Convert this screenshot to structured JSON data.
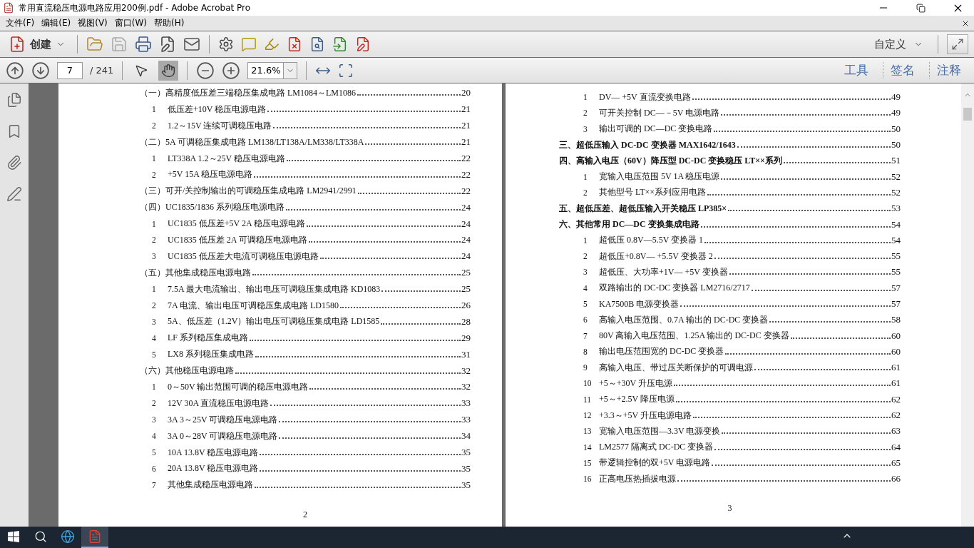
{
  "window": {
    "title": "常用直流稳压电源电路应用200例.pdf - Adobe Acrobat Pro"
  },
  "menu": [
    "文件(F)",
    "编辑(E)",
    "视图(V)",
    "窗口(W)",
    "帮助(H)"
  ],
  "toolbar": {
    "create": "创建",
    "customize": "自定义"
  },
  "navigation": {
    "page": "7",
    "page_count": "/ 241",
    "zoom": "21.6%",
    "tools": [
      {
        "kind": "select",
        "selected": false
      },
      {
        "kind": "hand",
        "selected": true
      }
    ]
  },
  "panels": [
    "工具",
    "签名",
    "注释"
  ],
  "pages": [
    {
      "number": "2",
      "entries": [
        {
          "kind": "section",
          "title": "（一）高精度低压差三端稳压集成电路 LM1084～LM1086",
          "page": "20"
        },
        {
          "kind": "item",
          "index": "1",
          "title": "低压差+10V 稳压电源电路",
          "page": "21"
        },
        {
          "kind": "item",
          "index": "2",
          "title": "1.2～15V 连续可调稳压电路",
          "page": "21"
        },
        {
          "kind": "section",
          "title": "（二）5A 可调稳压集成电路 LM138/LT138A/LM338/LT338A",
          "page": "21"
        },
        {
          "kind": "item",
          "index": "1",
          "title": "LT338A 1.2～25V 稳压电源电路",
          "page": "22"
        },
        {
          "kind": "item",
          "index": "2",
          "title": "+5V 15A 稳压电源电路",
          "page": "22"
        },
        {
          "kind": "section",
          "title": "（三）可开/关控制输出的可调稳压集成电路 LM2941/2991",
          "page": "22"
        },
        {
          "kind": "section",
          "title": "（四）UC1835/1836 系列稳压电源电路",
          "page": "24"
        },
        {
          "kind": "item",
          "index": "1",
          "title": "UC1835 低压差+5V 2A 稳压电源电路",
          "page": "24"
        },
        {
          "kind": "item",
          "index": "2",
          "title": "UC1835 低压差 2A 可调稳压电源电路",
          "page": "24"
        },
        {
          "kind": "item",
          "index": "3",
          "title": "UC1835 低压差大电流可调稳压电源电路",
          "page": "24"
        },
        {
          "kind": "section",
          "title": "（五）其他集成稳压电源电路",
          "page": "25"
        },
        {
          "kind": "item",
          "index": "1",
          "title": "7.5A 最大电流输出、输出电压可调稳压集成电路 KD1083",
          "page": "25"
        },
        {
          "kind": "item",
          "index": "2",
          "title": "7A 电流、输出电压可调稳压集成电路 LD1580",
          "page": "26"
        },
        {
          "kind": "item",
          "index": "3",
          "title": "5A、低压差（1.2V）输出电压可调稳压集成电路 LD1585",
          "page": "28"
        },
        {
          "kind": "item",
          "index": "4",
          "title": "LF 系列稳压集成电路",
          "page": "29"
        },
        {
          "kind": "item",
          "index": "5",
          "title": "LX8 系列稳压集成电路",
          "page": "31"
        },
        {
          "kind": "section",
          "title": "（六）其他稳压电源电路",
          "page": "32"
        },
        {
          "kind": "item",
          "index": "1",
          "title": "0～50V 输出范围可调的稳压电源电路",
          "page": "32"
        },
        {
          "kind": "item",
          "index": "2",
          "title": "12V 30A 直流稳压电源电路",
          "page": "33"
        },
        {
          "kind": "item",
          "index": "3",
          "title": "3A 3～25V 可调稳压电源电路",
          "page": "33"
        },
        {
          "kind": "item",
          "index": "4",
          "title": "3A 0～28V 可调稳压电源电路",
          "page": "34"
        },
        {
          "kind": "item",
          "index": "5",
          "title": "10A 13.8V 稳压电源电路",
          "page": "35"
        },
        {
          "kind": "item",
          "index": "6",
          "title": "20A 13.8V 稳压电源电路",
          "page": "35"
        },
        {
          "kind": "item",
          "index": "7",
          "title": "其他集成稳压电源电路",
          "page": "35"
        }
      ]
    },
    {
      "number": "3",
      "entries": [
        {
          "kind": "item",
          "index": "1",
          "title": "DV— +5V 直流变换电路",
          "page": "49"
        },
        {
          "kind": "item",
          "index": "2",
          "title": "可开关控制 DC—－5V 电源电路",
          "page": "49"
        },
        {
          "kind": "item",
          "index": "3",
          "title": "输出可调的 DC—DC 变换电路",
          "page": "50"
        },
        {
          "kind": "chapter",
          "title": "三、超低压输入 DC-DC 变换器 MAX1642/1643",
          "page": "50"
        },
        {
          "kind": "chapter",
          "title": "四、高输入电压（60V）降压型 DC-DC 变换稳压 LT××系列",
          "page": "51"
        },
        {
          "kind": "item",
          "index": "1",
          "title": "宽输入电压范围 5V 1A 稳压电源",
          "page": "52"
        },
        {
          "kind": "item",
          "index": "2",
          "title": "其他型号 LT××系列应用电路",
          "page": "52"
        },
        {
          "kind": "chapter",
          "title": "五、超低压差、超低压输入开关稳压 LP385×",
          "page": "53"
        },
        {
          "kind": "chapter",
          "title": "六、其他常用 DC—DC 变换集成电路",
          "page": "54"
        },
        {
          "kind": "item",
          "index": "1",
          "title": "超低压 0.8V—5.5V 变换器 1",
          "page": "54"
        },
        {
          "kind": "item",
          "index": "2",
          "title": "超低压+0.8V— +5.5V 变换器 2",
          "page": "55"
        },
        {
          "kind": "item",
          "index": "3",
          "title": "超低压、大功率+1V— +5V 变换器",
          "page": "55"
        },
        {
          "kind": "item",
          "index": "4",
          "title": "双路输出的 DC-DC 变换器 LM2716/2717",
          "page": "57"
        },
        {
          "kind": "item",
          "index": "5",
          "title": "KA7500B 电源变换器",
          "page": "57"
        },
        {
          "kind": "item",
          "index": "6",
          "title": "高输入电压范围、0.7A 输出的 DC-DC 变换器",
          "page": "58"
        },
        {
          "kind": "item",
          "index": "7",
          "title": "80V 高输入电压范围、1.25A 输出的 DC-DC 变换器",
          "page": "60"
        },
        {
          "kind": "item",
          "index": "8",
          "title": "输出电压范围宽的 DC-DC 变换器",
          "page": "60"
        },
        {
          "kind": "item",
          "index": "9",
          "title": "高输入电压、带过压关断保护的可调电源",
          "page": "61"
        },
        {
          "kind": "item",
          "index": "10",
          "title": "+5～+30V 升压电源",
          "page": "61"
        },
        {
          "kind": "item",
          "index": "11",
          "title": "+5～+2.5V 降压电源",
          "page": "62"
        },
        {
          "kind": "item",
          "index": "12",
          "title": "+3.3～+5V 升压电源电路",
          "page": "62"
        },
        {
          "kind": "item",
          "index": "13",
          "title": "宽输入电压范围—3.3V 电源变换",
          "page": "63"
        },
        {
          "kind": "item",
          "index": "14",
          "title": "LM2577 隔离式 DC-DC 变换器",
          "page": "64"
        },
        {
          "kind": "item",
          "index": "15",
          "title": "带逻辑控制的双+5V 电源电路",
          "page": "65"
        },
        {
          "kind": "item",
          "index": "16",
          "title": "正高电压热插拔电源",
          "page": "66"
        }
      ]
    }
  ],
  "taskbar": {
    "apps": [
      {
        "kind": "browser",
        "selected": false
      },
      {
        "kind": "acrobat",
        "selected": true
      }
    ]
  }
}
